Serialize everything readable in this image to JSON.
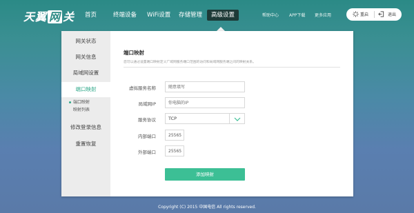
{
  "brand": {
    "pre": "天翼",
    "badge": "网",
    "post": "关"
  },
  "nav": {
    "items": [
      "首页",
      "终端设备",
      "WiFi设置",
      "存储管理",
      "高级设置"
    ],
    "active_index": 4
  },
  "util_links": [
    "帮助中心",
    "APP下载",
    "更多应用"
  ],
  "actions": {
    "restart": "重启",
    "logout": "退出"
  },
  "sidebar": {
    "items": [
      "网关状态",
      "网关信息",
      "局域网设置",
      "端口映射",
      "修改登录信息",
      "重置恢复"
    ],
    "active_index": 3,
    "sub_items": [
      "端口映射",
      "映射列表"
    ]
  },
  "content": {
    "title": "端口映射",
    "description": "您可以通过设置端口映射定义广域网服务端口范围的访问和局域网服务端之间的映射关系。"
  },
  "form": {
    "service_name_label": "虚拟服务名称",
    "service_name_placeholder": "随意填写",
    "lan_ip_label": "局域网IP",
    "lan_ip_placeholder": "你电脑的IP",
    "protocol_label": "服务协议",
    "protocol_value": "TCP",
    "internal_port_label": "内部端口",
    "internal_port_value": "25565",
    "external_port_label": "外部端口",
    "external_port_value": "25565",
    "submit_label": "添加映射"
  },
  "footer": {
    "copyright": "Copyright (C) 2015 中国电信 All rights reserved."
  },
  "colors": {
    "accent": "#3cbf95",
    "nav_active": "#1d3a37",
    "active_text": "#2fa889"
  }
}
